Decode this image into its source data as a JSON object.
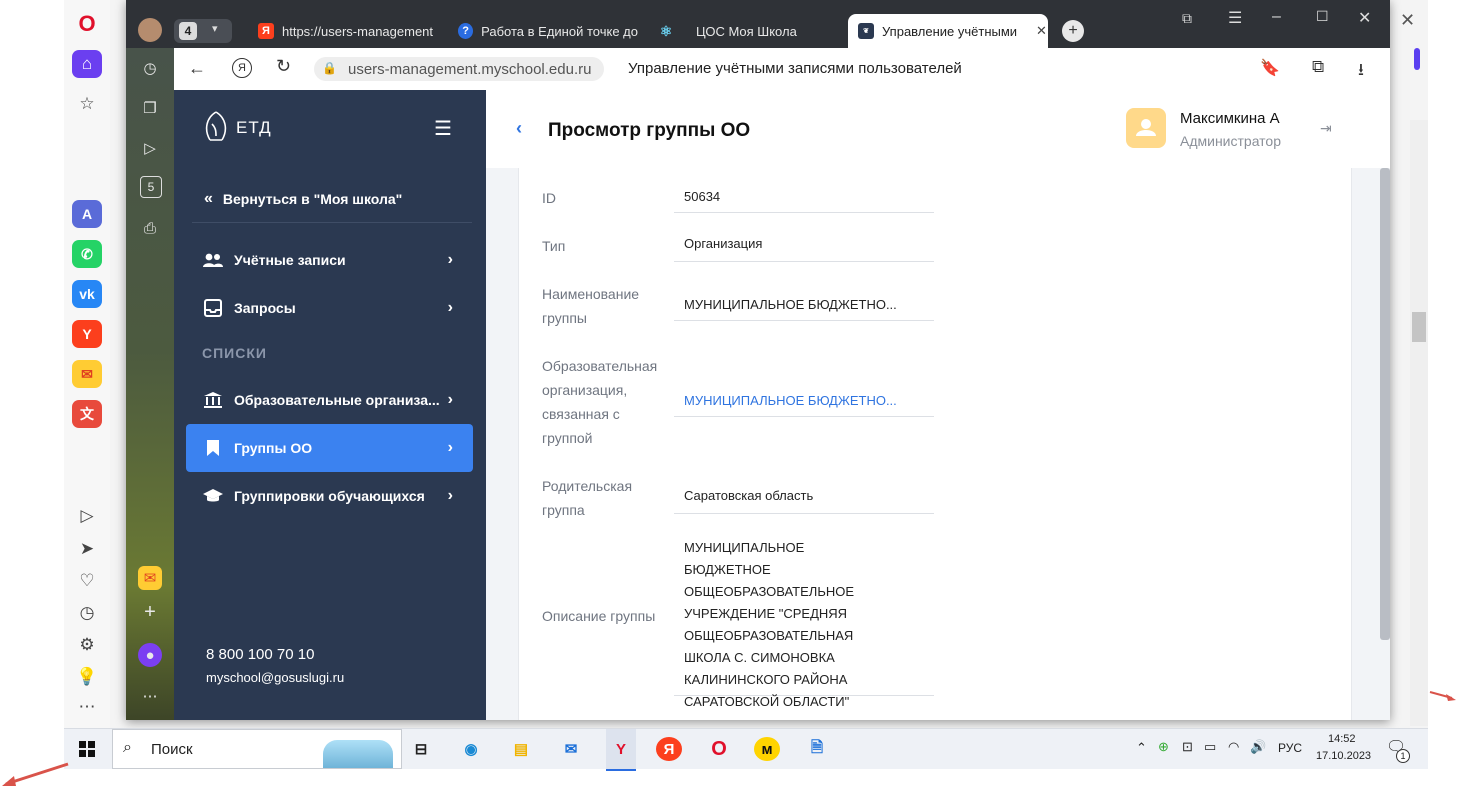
{
  "browser": {
    "tab_count": "4",
    "tabs": [
      {
        "title": "https://users-management",
        "favicon": "Я"
      },
      {
        "title": "Работа в Единой точке до",
        "favicon": "?"
      },
      {
        "title": "ЦОС Моя Школа",
        "favicon": "⚛"
      },
      {
        "title": "Управление учётными",
        "favicon": "ETD"
      }
    ],
    "url": "users-management.myschool.edu.ru",
    "page_title": "Управление учётными записями пользователей"
  },
  "app": {
    "logo_text": "ЕТД",
    "back_link": "Вернуться в \"Моя школа\"",
    "nav": [
      {
        "label": "Учётные записи",
        "icon": "users-icon"
      },
      {
        "label": "Запросы",
        "icon": "inbox-icon"
      }
    ],
    "section_title": "СПИСКИ",
    "lists": [
      {
        "label": "Образовательные организа...",
        "icon": "institution-icon"
      },
      {
        "label": "Группы ОО",
        "icon": "bookmark-icon"
      },
      {
        "label": "Группировки обучающихся",
        "icon": "graduation-cap-icon"
      }
    ],
    "phone": "8 800 100 70 10",
    "email": "myschool@gosuslugi.ru"
  },
  "header": {
    "title": "Просмотр группы ОО",
    "user_name": "Максимкина А",
    "user_role": "Администратор"
  },
  "fields": {
    "id_label": "ID",
    "id_value": "50634",
    "type_label": "Тип",
    "type_value": "Организация",
    "name_label": "Наименование группы",
    "name_value": "МУНИЦИПАЛЬНОЕ БЮДЖЕТНО...",
    "org_label": "Образовательная организация, связанная с группой",
    "org_value": "МУНИЦИПАЛЬНОЕ БЮДЖЕТНО...",
    "parent_label": "Родительская группа",
    "parent_value": "Саратовская область",
    "desc_label": "Описание группы",
    "desc_value": "МУНИЦИПАЛЬНОЕ БЮДЖЕТНОЕ ОБЩЕОБРАЗОВАТЕЛЬНОЕ УЧРЕЖДЕНИЕ \"СРЕДНЯЯ ОБЩЕОБРАЗОВАТЕЛЬНАЯ ШКОЛА С. СИМОНОВКА КАЛИНИНСКОГО РАЙОНА САРАТОВСКОЙ ОБЛАСТИ\""
  },
  "taskbar": {
    "search_placeholder": "Поиск",
    "language": "РУС",
    "time": "14:52",
    "date": "17.10.2023",
    "notification_count": "1"
  },
  "colors": {
    "nav_bg": "#2b3951",
    "nav_active": "#3b82f0",
    "link": "#2f74e0",
    "avatar": "#ffd98a"
  }
}
